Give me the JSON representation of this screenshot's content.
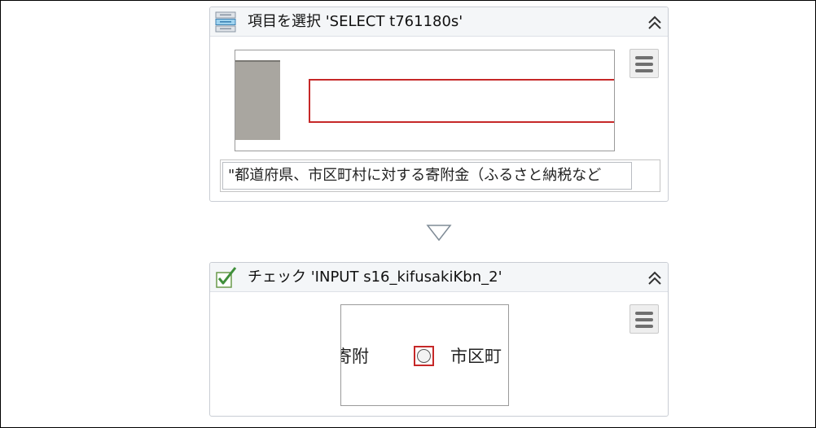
{
  "step1": {
    "title": "項目を選択 'SELECT  t761180s'",
    "icon": "select-list-icon",
    "selected_value": "\"都道府県、市区町村に対する寄附金（ふるさと納税など"
  },
  "step2": {
    "title": "チェック 'INPUT  s16_kifusakiKbn_2'",
    "icon": "checkbox-check-icon",
    "preview_left_text": "寄附",
    "preview_right_text": "市区町"
  },
  "colors": {
    "accent_red": "#c62828",
    "check_green": "#3f8f3a",
    "header_bg": "#f4f6f8"
  }
}
